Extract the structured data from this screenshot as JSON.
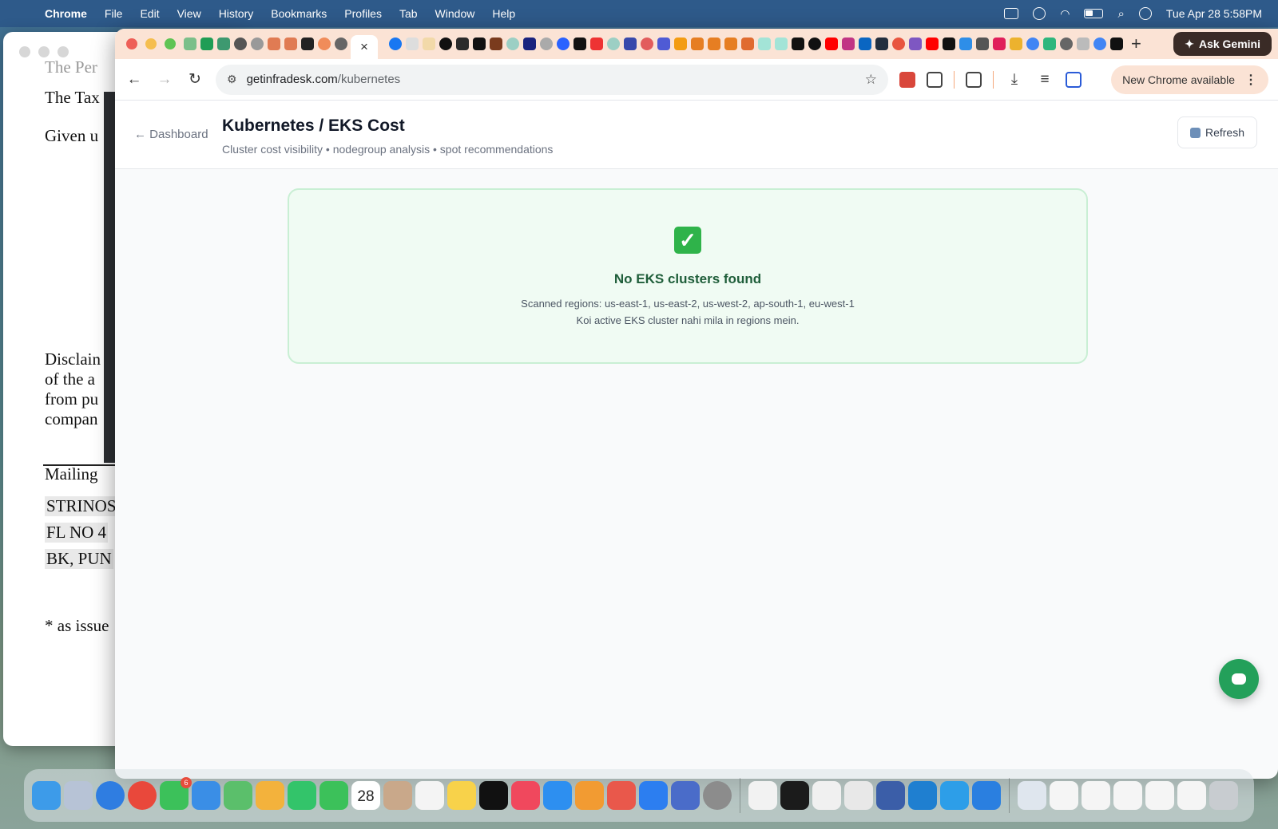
{
  "menubar": {
    "app_name": "Chrome",
    "items": [
      "File",
      "Edit",
      "View",
      "History",
      "Bookmarks",
      "Profiles",
      "Tab",
      "Window",
      "Help"
    ],
    "clock": "Tue Apr 28  5:58PM"
  },
  "background_doc": {
    "lines": [
      "The Per",
      "The Tax",
      "Given u",
      "Disclain",
      "of the a",
      "from pu",
      "compan",
      "Mailing",
      "STRINOS",
      "FL NO 4",
      "BK, PUN",
      "* as issue"
    ]
  },
  "browser": {
    "active_tab_close": "×",
    "new_tab": "+",
    "ask_gemini": "Ask Gemini",
    "url_host": "getinfradesk.com",
    "url_path": "/kubernetes",
    "new_chrome": "New Chrome available"
  },
  "page": {
    "back_label": "← Dashboard",
    "title": "Kubernetes / EKS Cost",
    "subtitle": "Cluster cost visibility • nodegroup analysis • spot recommendations",
    "refresh_label": "Refresh",
    "empty_state": {
      "icon": "✓",
      "title": "No EKS clusters found",
      "line1": "Scanned regions: us-east-1, us-east-2, us-west-2, ap-south-1, eu-west-1",
      "line2": "Koi active EKS cluster nahi mila in regions mein."
    }
  },
  "dock": {
    "calendar_day": "28",
    "messages_badge": "6"
  },
  "colors": {
    "accent_green": "#23a05a",
    "card_bg": "#f0fbf3",
    "card_border": "#c9efd4",
    "tabstrip": "#fbe3d5"
  }
}
